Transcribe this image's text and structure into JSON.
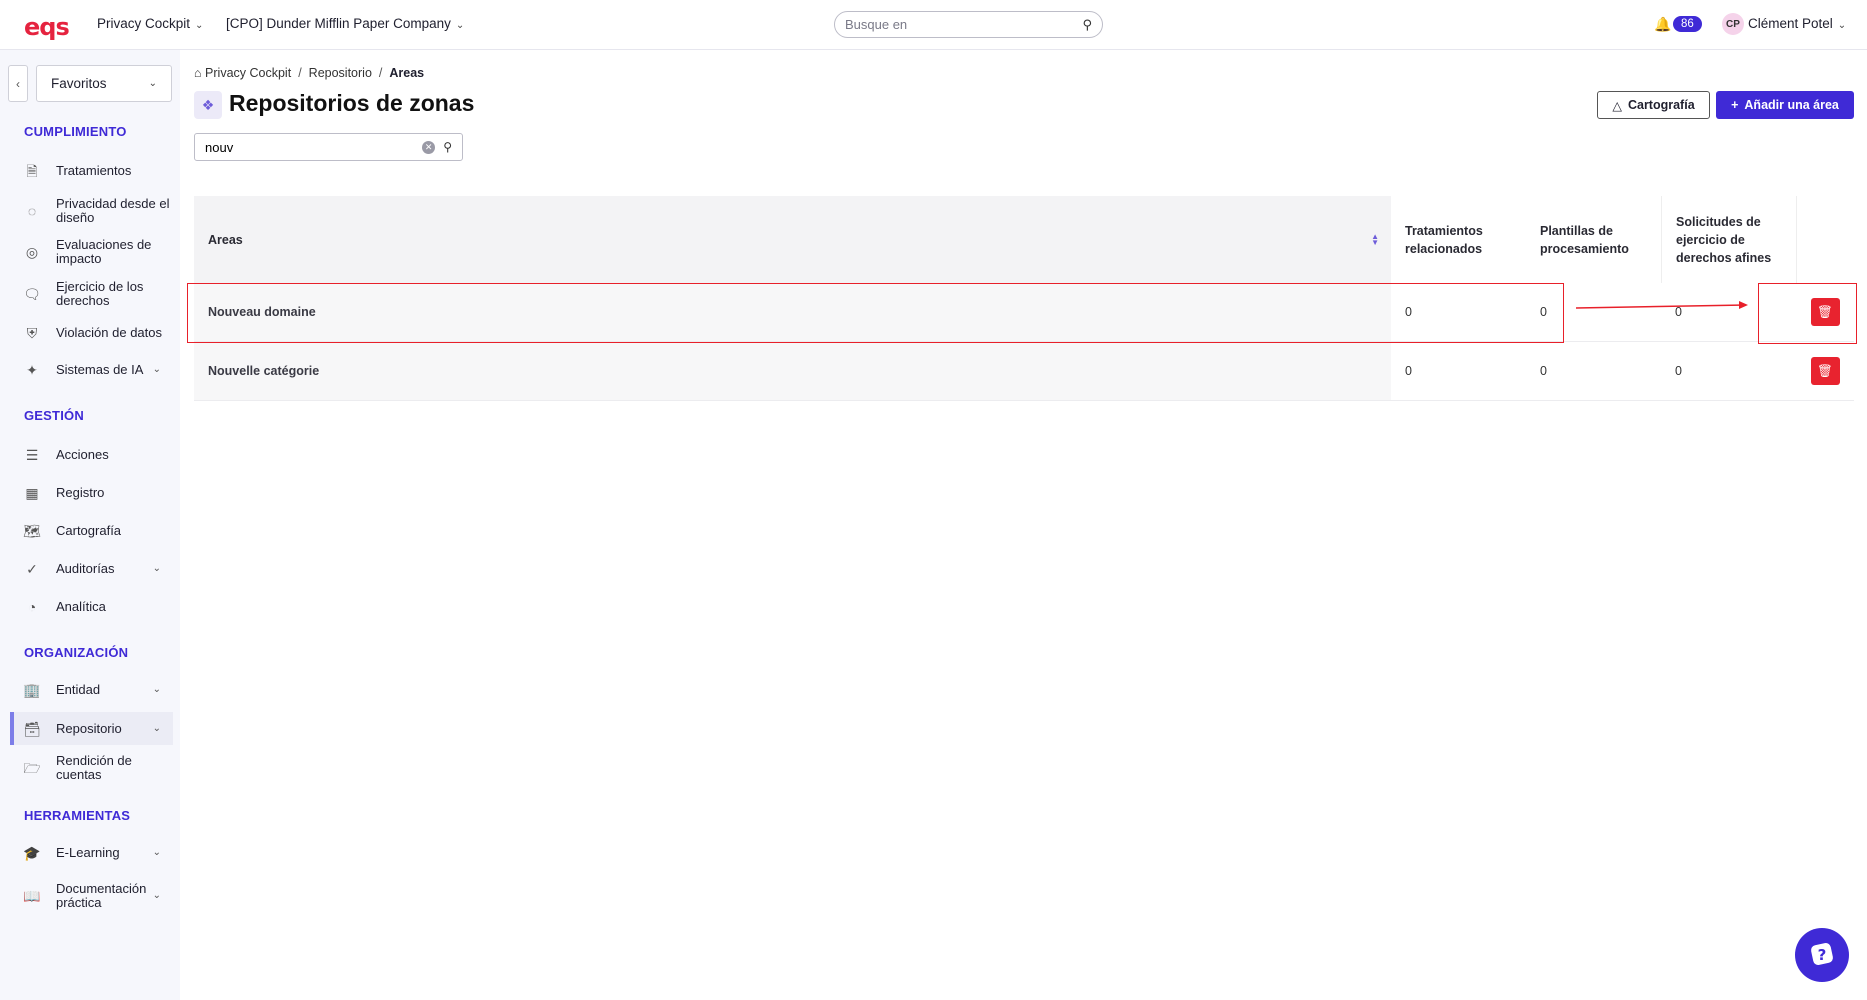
{
  "header": {
    "logo": "eqs",
    "module": "Privacy Cockpit",
    "company": "[CPO] Dunder Mifflin Paper Company",
    "search_placeholder": "Busque en",
    "notifications": "86",
    "user_initials": "CP",
    "user_name": "Clément Potel"
  },
  "sidebar": {
    "favorites": "Favoritos",
    "sections": [
      {
        "title": "CUMPLIMIENTO"
      },
      {
        "title": "GESTIÓN"
      },
      {
        "title": "ORGANIZACIÓN"
      },
      {
        "title": "HERRAMIENTAS"
      }
    ],
    "items": [
      {
        "label": "Tratamientos",
        "icon": "document-icon"
      },
      {
        "label": "Privacidad desde el diseño",
        "icon": "design-icon"
      },
      {
        "label": "Evaluaciones de impacto",
        "icon": "impact-icon"
      },
      {
        "label": "Ejercicio de los derechos",
        "icon": "chat-icon"
      },
      {
        "label": "Violación de datos",
        "icon": "shield-icon"
      },
      {
        "label": "Sistemas de IA",
        "icon": "sparkle-icon"
      },
      {
        "label": "Acciones",
        "icon": "list-icon"
      },
      {
        "label": "Registro",
        "icon": "table-icon"
      },
      {
        "label": "Cartografía",
        "icon": "map-icon"
      },
      {
        "label": "Auditorías",
        "icon": "check-circle-icon"
      },
      {
        "label": "Analítica",
        "icon": "pie-icon"
      },
      {
        "label": "Entidad",
        "icon": "building-icon"
      },
      {
        "label": "Repositorio",
        "icon": "archive-icon"
      },
      {
        "label": "Rendición de cuentas",
        "icon": "folder-icon"
      },
      {
        "label": "E-Learning",
        "icon": "graduation-icon"
      },
      {
        "label": "Documentación práctica",
        "icon": "book-icon"
      }
    ]
  },
  "breadcrumb": {
    "home": "Privacy Cockpit",
    "parent": "Repositorio",
    "current": "Areas"
  },
  "page": {
    "title": "Repositorios de zonas",
    "cartography_button": "Cartografía",
    "add_button": "Añadir una área",
    "filter_value": "nouv"
  },
  "table": {
    "headers": {
      "areas": "Areas",
      "related_treatments": "Tratamientos relacionados",
      "processing_templates": "Plantillas de procesamiento",
      "rights_requests": "Solicitudes de ejercicio de derechos afines"
    },
    "rows": [
      {
        "area": "Nouveau domaine",
        "treatments": "0",
        "templates": "0",
        "requests": "0"
      },
      {
        "area": "Nouvelle catégorie",
        "treatments": "0",
        "templates": "0",
        "requests": "0"
      }
    ]
  },
  "colors": {
    "accent": "#3f2ad6",
    "danger": "#e8232f",
    "brand": "#e5233f",
    "annotation": "#e8202a"
  }
}
